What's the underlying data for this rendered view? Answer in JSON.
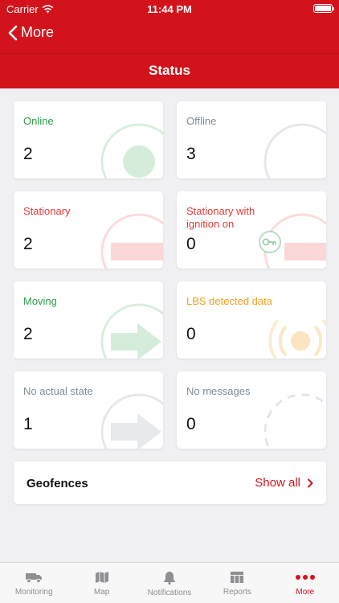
{
  "statusbar": {
    "carrier": "Carrier",
    "time": "11:44 PM"
  },
  "nav": {
    "back_label": "More",
    "title": "Status"
  },
  "cards": [
    {
      "label": "Online",
      "count": "2",
      "color": "#2e9e4a",
      "icon": "online-dot-icon"
    },
    {
      "label": "Offline",
      "count": "3",
      "color": "#7c8b98",
      "icon": "offline-ring-icon"
    },
    {
      "label": "Stationary",
      "count": "2",
      "color": "#e03b36",
      "icon": "stationary-bar-icon"
    },
    {
      "label": "Stationary with ignition on",
      "count": "0",
      "color": "#e03b36",
      "icon": "key-icon"
    },
    {
      "label": "Moving",
      "count": "2",
      "color": "#2e9e4a",
      "icon": "arrow-right-icon"
    },
    {
      "label": "LBS detected data",
      "count": "0",
      "color": "#f0a01c",
      "icon": "signal-waves-icon"
    },
    {
      "label": "No actual state",
      "count": "1",
      "color": "#7c8b98",
      "icon": "arrow-right-icon"
    },
    {
      "label": "No messages",
      "count": "0",
      "color": "#7c8b98",
      "icon": "dashed-ring-icon"
    }
  ],
  "geofences": {
    "title": "Geofences",
    "action": "Show all"
  },
  "tabs": [
    {
      "label": "Monitoring",
      "icon": "truck-icon"
    },
    {
      "label": "Map",
      "icon": "map-icon"
    },
    {
      "label": "Notifications",
      "icon": "bell-icon"
    },
    {
      "label": "Reports",
      "icon": "reports-icon"
    },
    {
      "label": "More",
      "icon": "more-dots-icon",
      "active": true
    }
  ],
  "colors": {
    "brand": "#d3131b",
    "background": "#f0f0f3"
  }
}
